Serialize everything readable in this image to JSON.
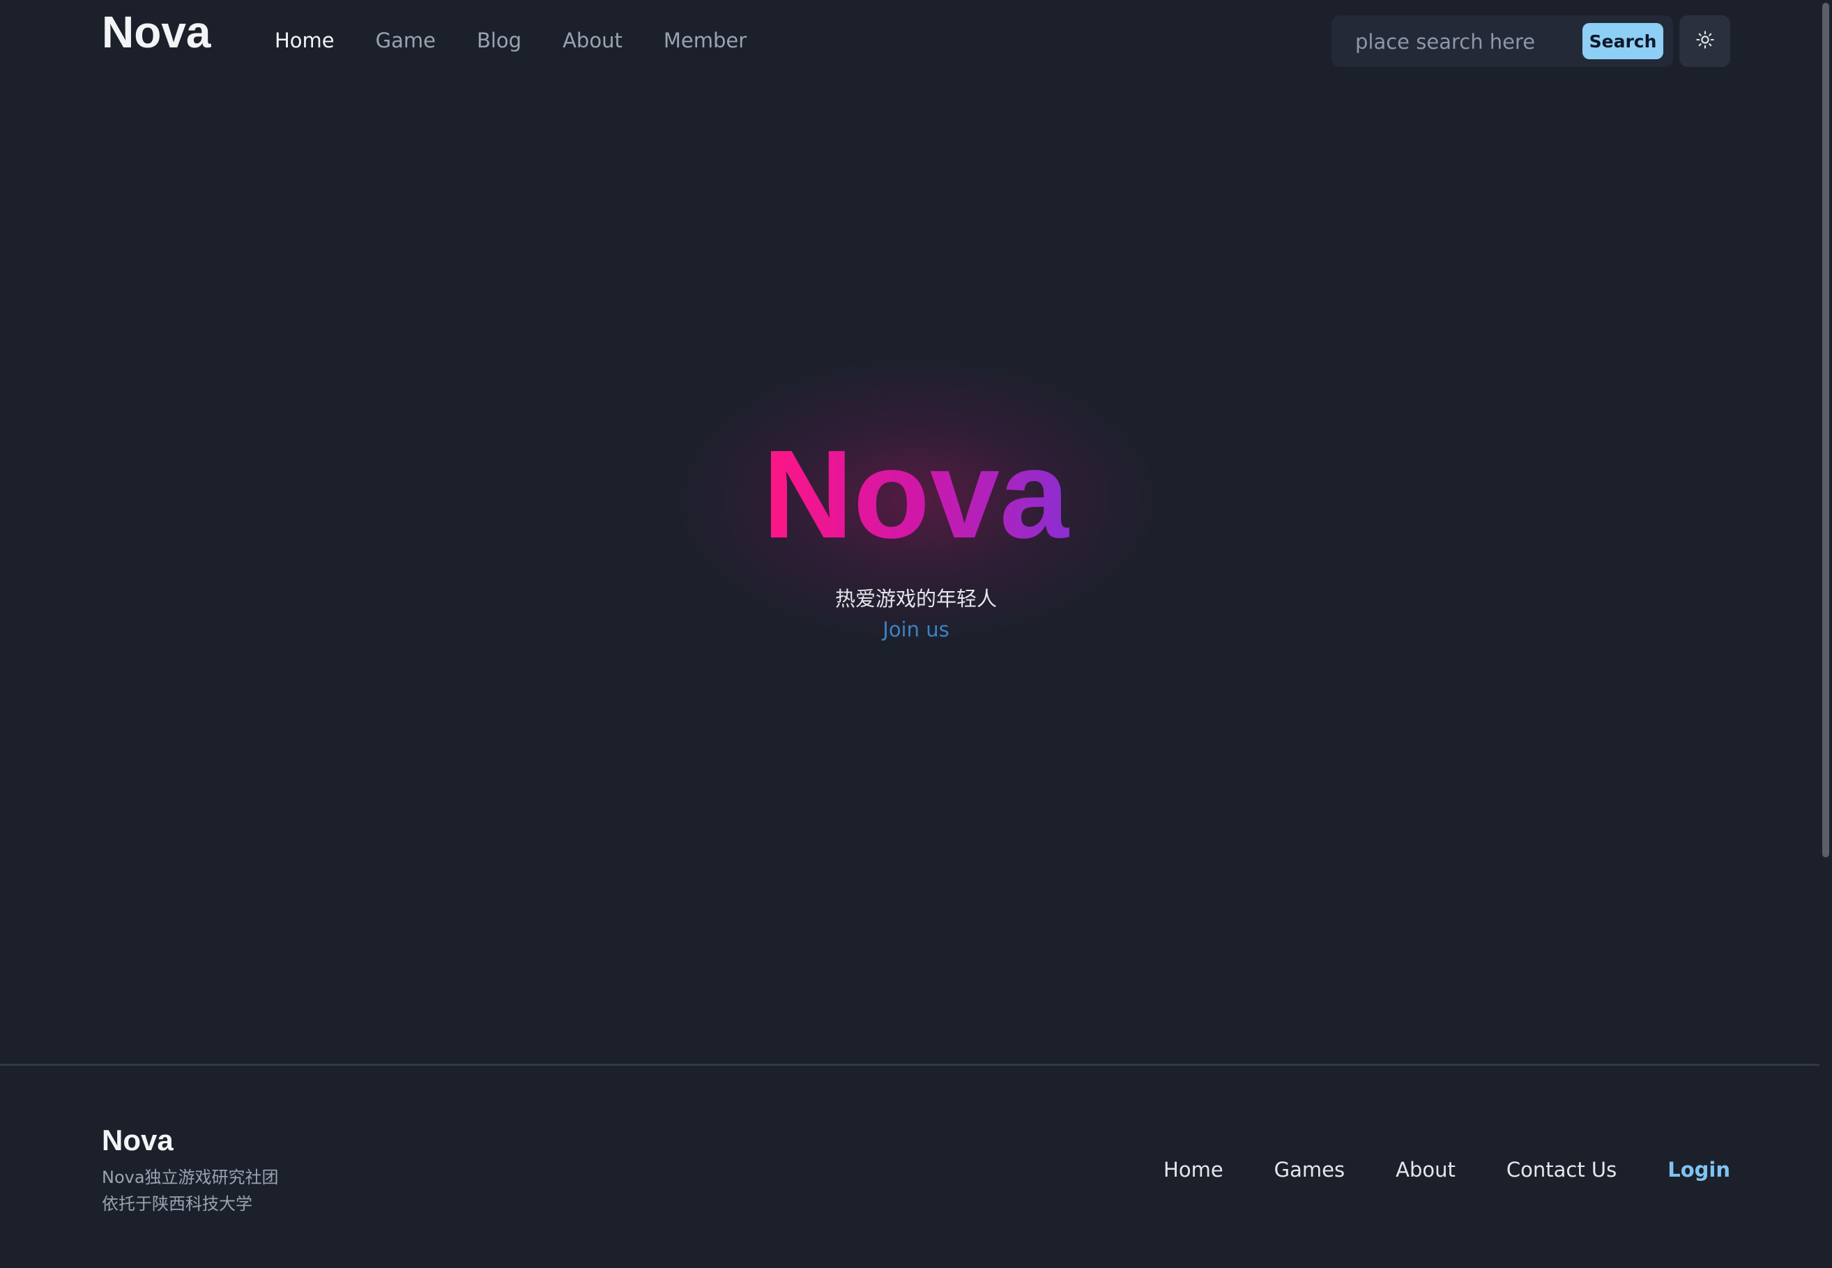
{
  "header": {
    "brand": "Nova",
    "nav": [
      {
        "label": "Home",
        "active": true
      },
      {
        "label": "Game",
        "active": false
      },
      {
        "label": "Blog",
        "active": false
      },
      {
        "label": "About",
        "active": false
      },
      {
        "label": "Member",
        "active": false
      }
    ],
    "search": {
      "placeholder": "place search here",
      "value": "",
      "button_label": "Search"
    },
    "theme_toggle_icon": "sun-icon"
  },
  "hero": {
    "title": "Nova",
    "subtitle": "热爱游戏的年轻人",
    "cta": "Join us"
  },
  "footer": {
    "brand": "Nova",
    "line1": "Nova独立游戏研究社团",
    "line2": "依托于陕西科技大学",
    "links": [
      "Home",
      "Games",
      "About",
      "Contact Us"
    ],
    "login": "Login"
  },
  "colors": {
    "background": "#1b202b",
    "accent": "#8ecff5",
    "link": "#3b82c4",
    "gradient_start": "#ff1685",
    "gradient_end": "#8b2fd1"
  }
}
